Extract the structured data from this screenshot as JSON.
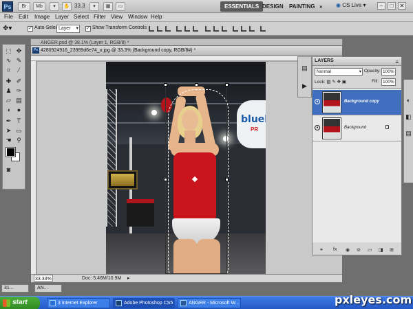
{
  "appbar": {
    "logo": "Ps",
    "buttons": [
      "Br",
      "Mb"
    ],
    "zoom": "33.3",
    "workspaces": [
      "ESSENTIALS",
      "DESIGN",
      "PAINTING",
      "»"
    ],
    "cs_live": "CS Live",
    "window_controls": [
      "–",
      "□",
      "✕"
    ]
  },
  "menu": [
    "File",
    "Edit",
    "Image",
    "Layer",
    "Select",
    "Filter",
    "View",
    "Window",
    "Help"
  ],
  "options_bar": {
    "auto_select_label": "Auto-Select:",
    "auto_select_value": "Layer",
    "show_transform_label": "Show Transform Controls"
  },
  "documents": {
    "background_title": "ANGER.psd @ 38.1% (Layer 1, RGB/8) *",
    "active_title": "4280924916_23989d6e74_o.jpg @ 33.3% (Background copy, RGB/8#) *",
    "status_zoom": "33.33%",
    "status_doc": "Doc: 5.46M/10.9M"
  },
  "photo": {
    "sign_text": "blueb",
    "sign_sub": "PR"
  },
  "layers_panel": {
    "title": "LAYERS",
    "blend_mode": "Normal",
    "opacity_label": "Opacity:",
    "opacity_value": "100%",
    "lock_label": "Lock:",
    "fill_label": "Fill:",
    "fill_value": "100%",
    "layers": [
      {
        "name": "Background copy",
        "selected": true
      },
      {
        "name": "Background",
        "selected": false
      }
    ],
    "footer_icons": [
      "fx",
      "◉",
      "⊘",
      "▭",
      "◨",
      "⊞"
    ]
  },
  "mini_tabs": [
    "31...",
    "AN..."
  ],
  "taskbar": {
    "start": "start",
    "buttons": [
      "3 Internet Explorer",
      "Adobe Photoshop CS5",
      "ANGER - Microsoft W..."
    ]
  },
  "watermark": "pxleyes.com",
  "colors": {
    "selected_layer": "#3f6fbe",
    "tank_top": "#c9131d",
    "taskbar": "#2458c7"
  }
}
